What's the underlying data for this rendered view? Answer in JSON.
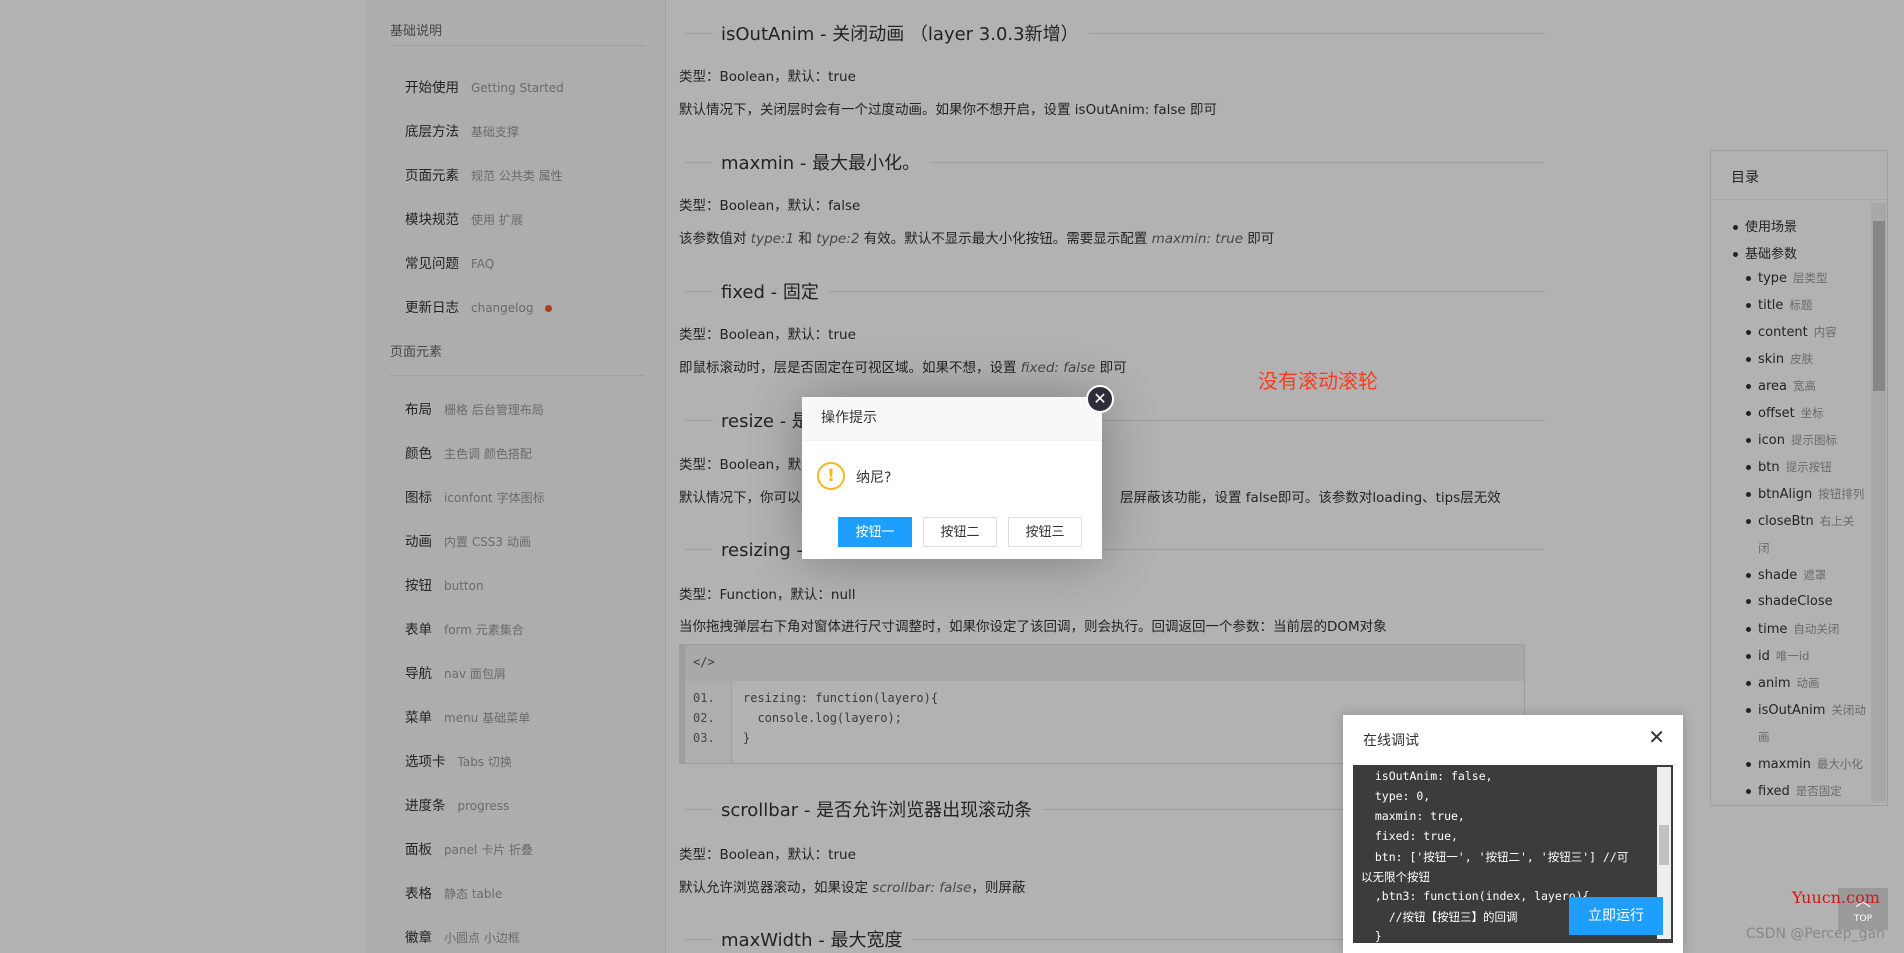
{
  "sidebar": {
    "head1": "基础说明",
    "items1": [
      {
        "label": "开始使用",
        "sub": "Getting Started"
      },
      {
        "label": "底层方法",
        "sub": "基础支撑"
      },
      {
        "label": "页面元素",
        "sub": "规范 公共类 属性"
      },
      {
        "label": "模块规范",
        "sub": "使用 扩展"
      },
      {
        "label": "常见问题",
        "sub": "FAQ"
      },
      {
        "label": "更新日志",
        "sub": "changelog"
      }
    ],
    "head2": "页面元素",
    "items2": [
      {
        "label": "布局",
        "sub": "栅格 后台管理布局"
      },
      {
        "label": "颜色",
        "sub": "主色调 颜色搭配"
      },
      {
        "label": "图标",
        "sub": "iconfont 字体图标"
      },
      {
        "label": "动画",
        "sub": "内置 CSS3 动画"
      },
      {
        "label": "按钮",
        "sub": "button"
      },
      {
        "label": "表单",
        "sub": "form 元素集合"
      },
      {
        "label": "导航",
        "sub": "nav 面包屑"
      },
      {
        "label": "菜单",
        "sub": "menu 基础菜单"
      },
      {
        "label": "选项卡",
        "sub": "Tabs 切换"
      },
      {
        "label": "进度条",
        "sub": "progress"
      },
      {
        "label": "面板",
        "sub": "panel 卡片 折叠"
      },
      {
        "label": "表格",
        "sub": "静态 table"
      },
      {
        "label": "徽章",
        "sub": "小圆点 小边框"
      }
    ]
  },
  "main": {
    "sections": [
      {
        "title": "isOutAnim - 关闭动画 （layer 3.0.3新增）"
      },
      {
        "title": "maxmin - 最大最小化。"
      },
      {
        "title": "fixed - 固定"
      },
      {
        "title": "resize - 是否"
      },
      {
        "title": "resizing - 窗"
      },
      {
        "title": "scrollbar - 是否允许浏览器出现滚动条"
      },
      {
        "title": "maxWidth - 最大宽度"
      }
    ],
    "p": [
      "类型：Boolean，默认：true",
      "默认情况下，关闭层时会有一个过度动画。如果你不想开启，设置 isOutAnim: false 即可",
      "类型：Boolean，默认：false",
      "该参数值对 ",
      "type:1",
      " 和 ",
      "type:2",
      " 有效。默认不显示最大小化按钮。需要显示配置 ",
      "maxmin: true",
      " 即可",
      "类型：Boolean，默认：true",
      "即鼠标滚动时，层是否固定在可视区域。如果不想，设置 ",
      "fixed: false",
      " 即可",
      "类型：Boolean，默",
      "默认情况下，你可以",
      "层屏蔽该功能，设置 false即可。该参数对loading、tips层无效",
      "类型：Function，默认：null",
      "当你拖拽弹层右下角对窗体进行尺寸调整时，如果你设定了该回调，则会执行。回调返回一个参数：当前层的DOM对象",
      "类型：Boolean，默认：true",
      "默认允许浏览器滚动，如果设定 ",
      "scrollbar: false",
      "，则屏蔽"
    ],
    "code_head": "</>",
    "code_lines": [
      {
        "num": "01.",
        "text": "resizing: function(layero){"
      },
      {
        "num": "02.",
        "text": "  console.log(layero);"
      },
      {
        "num": "03.",
        "text": "}"
      }
    ]
  },
  "annotation": "没有滚动滚轮",
  "toc": {
    "title": "目录",
    "items": [
      {
        "label": "使用场景",
        "sub": "",
        "level": 1
      },
      {
        "label": "基础参数",
        "sub": "",
        "level": 1
      },
      {
        "label": "type",
        "sub": "层类型",
        "level": 2
      },
      {
        "label": "title",
        "sub": "标题",
        "level": 2
      },
      {
        "label": "content",
        "sub": "内容",
        "level": 2
      },
      {
        "label": "skin",
        "sub": "皮肤",
        "level": 2
      },
      {
        "label": "area",
        "sub": "宽高",
        "level": 2
      },
      {
        "label": "offset",
        "sub": "坐标",
        "level": 2
      },
      {
        "label": "icon",
        "sub": "提示图标",
        "level": 2
      },
      {
        "label": "btn",
        "sub": "提示按钮",
        "level": 2
      },
      {
        "label": "btnAlign",
        "sub": "按钮排列",
        "level": 2
      },
      {
        "label": "closeBtn",
        "sub": "右上关",
        "level": 2
      },
      {
        "label": "",
        "sub": "闭",
        "level": 2
      },
      {
        "label": "shade",
        "sub": "遮罩",
        "level": 2
      },
      {
        "label": "shadeClose",
        "sub": "",
        "level": 2
      },
      {
        "label": "time",
        "sub": "自动关闭",
        "level": 2
      },
      {
        "label": "id",
        "sub": "唯一id",
        "level": 2
      },
      {
        "label": "anim",
        "sub": "动画",
        "level": 2
      },
      {
        "label": "isOutAnim",
        "sub": "关闭动",
        "level": 2
      },
      {
        "label": "",
        "sub": "画",
        "level": 2
      },
      {
        "label": "maxmin",
        "sub": "最大小化",
        "level": 2
      },
      {
        "label": "fixed",
        "sub": "是否固定",
        "level": 2
      }
    ]
  },
  "debug": {
    "title": "在线调试",
    "close": "✕",
    "code_lines": [
      "  isOutAnim: false,",
      "  type: 0,",
      "  maxmin: true,",
      "  fixed: true,",
      "  btn: ['按钮一', '按钮二', '按钮三'] //可",
      "以无限个按钮",
      "  ,btn3: function(index, layero){",
      "    //按钮【按钮三】的回调",
      "  }"
    ],
    "run_label": "立即运行"
  },
  "dialog": {
    "title": "操作提示",
    "close": "✕",
    "icon": "!",
    "message": "纳尼?",
    "buttons": [
      "按钮一",
      "按钮二",
      "按钮三"
    ]
  },
  "top_label": "TOP",
  "yuucn": "Yuucn.com",
  "watermark": "CSDN @Percep_gan"
}
